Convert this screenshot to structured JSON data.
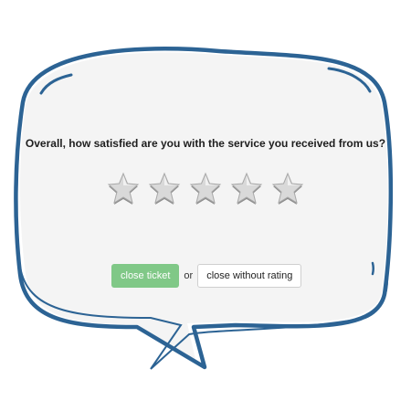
{
  "prompt": {
    "question": "Overall, how satisfied are you with the service you received from us?"
  },
  "rating": {
    "max_stars": 5,
    "selected": 0
  },
  "actions": {
    "close_ticket_label": "close ticket",
    "or_label": "or",
    "close_without_rating_label": "close without rating"
  },
  "colors": {
    "bubble_stroke": "#2c6394",
    "bubble_fill": "#f4f4f4",
    "close_button": "#80c887",
    "star_fill": "#d9d9d9"
  }
}
